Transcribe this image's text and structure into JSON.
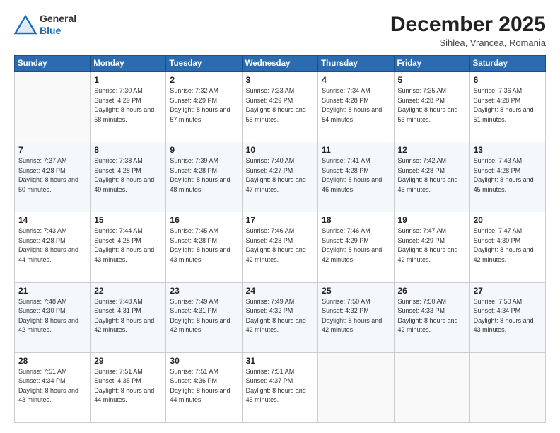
{
  "header": {
    "logo_general": "General",
    "logo_blue": "Blue",
    "month_title": "December 2025",
    "location": "Sihlea, Vrancea, Romania"
  },
  "weekdays": [
    "Sunday",
    "Monday",
    "Tuesday",
    "Wednesday",
    "Thursday",
    "Friday",
    "Saturday"
  ],
  "weeks": [
    [
      {
        "day": null,
        "sunrise": "",
        "sunset": "",
        "daylight": ""
      },
      {
        "day": "1",
        "sunrise": "7:30 AM",
        "sunset": "4:29 PM",
        "daylight": "8 hours and 58 minutes."
      },
      {
        "day": "2",
        "sunrise": "7:32 AM",
        "sunset": "4:29 PM",
        "daylight": "8 hours and 57 minutes."
      },
      {
        "day": "3",
        "sunrise": "7:33 AM",
        "sunset": "4:29 PM",
        "daylight": "8 hours and 55 minutes."
      },
      {
        "day": "4",
        "sunrise": "7:34 AM",
        "sunset": "4:28 PM",
        "daylight": "8 hours and 54 minutes."
      },
      {
        "day": "5",
        "sunrise": "7:35 AM",
        "sunset": "4:28 PM",
        "daylight": "8 hours and 53 minutes."
      },
      {
        "day": "6",
        "sunrise": "7:36 AM",
        "sunset": "4:28 PM",
        "daylight": "8 hours and 51 minutes."
      }
    ],
    [
      {
        "day": "7",
        "sunrise": "7:37 AM",
        "sunset": "4:28 PM",
        "daylight": "8 hours and 50 minutes."
      },
      {
        "day": "8",
        "sunrise": "7:38 AM",
        "sunset": "4:28 PM",
        "daylight": "8 hours and 49 minutes."
      },
      {
        "day": "9",
        "sunrise": "7:39 AM",
        "sunset": "4:28 PM",
        "daylight": "8 hours and 48 minutes."
      },
      {
        "day": "10",
        "sunrise": "7:40 AM",
        "sunset": "4:27 PM",
        "daylight": "8 hours and 47 minutes."
      },
      {
        "day": "11",
        "sunrise": "7:41 AM",
        "sunset": "4:28 PM",
        "daylight": "8 hours and 46 minutes."
      },
      {
        "day": "12",
        "sunrise": "7:42 AM",
        "sunset": "4:28 PM",
        "daylight": "8 hours and 45 minutes."
      },
      {
        "day": "13",
        "sunrise": "7:43 AM",
        "sunset": "4:28 PM",
        "daylight": "8 hours and 45 minutes."
      }
    ],
    [
      {
        "day": "14",
        "sunrise": "7:43 AM",
        "sunset": "4:28 PM",
        "daylight": "8 hours and 44 minutes."
      },
      {
        "day": "15",
        "sunrise": "7:44 AM",
        "sunset": "4:28 PM",
        "daylight": "8 hours and 43 minutes."
      },
      {
        "day": "16",
        "sunrise": "7:45 AM",
        "sunset": "4:28 PM",
        "daylight": "8 hours and 43 minutes."
      },
      {
        "day": "17",
        "sunrise": "7:46 AM",
        "sunset": "4:28 PM",
        "daylight": "8 hours and 42 minutes."
      },
      {
        "day": "18",
        "sunrise": "7:46 AM",
        "sunset": "4:29 PM",
        "daylight": "8 hours and 42 minutes."
      },
      {
        "day": "19",
        "sunrise": "7:47 AM",
        "sunset": "4:29 PM",
        "daylight": "8 hours and 42 minutes."
      },
      {
        "day": "20",
        "sunrise": "7:47 AM",
        "sunset": "4:30 PM",
        "daylight": "8 hours and 42 minutes."
      }
    ],
    [
      {
        "day": "21",
        "sunrise": "7:48 AM",
        "sunset": "4:30 PM",
        "daylight": "8 hours and 42 minutes."
      },
      {
        "day": "22",
        "sunrise": "7:48 AM",
        "sunset": "4:31 PM",
        "daylight": "8 hours and 42 minutes."
      },
      {
        "day": "23",
        "sunrise": "7:49 AM",
        "sunset": "4:31 PM",
        "daylight": "8 hours and 42 minutes."
      },
      {
        "day": "24",
        "sunrise": "7:49 AM",
        "sunset": "4:32 PM",
        "daylight": "8 hours and 42 minutes."
      },
      {
        "day": "25",
        "sunrise": "7:50 AM",
        "sunset": "4:32 PM",
        "daylight": "8 hours and 42 minutes."
      },
      {
        "day": "26",
        "sunrise": "7:50 AM",
        "sunset": "4:33 PM",
        "daylight": "8 hours and 42 minutes."
      },
      {
        "day": "27",
        "sunrise": "7:50 AM",
        "sunset": "4:34 PM",
        "daylight": "8 hours and 43 minutes."
      }
    ],
    [
      {
        "day": "28",
        "sunrise": "7:51 AM",
        "sunset": "4:34 PM",
        "daylight": "8 hours and 43 minutes."
      },
      {
        "day": "29",
        "sunrise": "7:51 AM",
        "sunset": "4:35 PM",
        "daylight": "8 hours and 44 minutes."
      },
      {
        "day": "30",
        "sunrise": "7:51 AM",
        "sunset": "4:36 PM",
        "daylight": "8 hours and 44 minutes."
      },
      {
        "day": "31",
        "sunrise": "7:51 AM",
        "sunset": "4:37 PM",
        "daylight": "8 hours and 45 minutes."
      },
      {
        "day": null,
        "sunrise": "",
        "sunset": "",
        "daylight": ""
      },
      {
        "day": null,
        "sunrise": "",
        "sunset": "",
        "daylight": ""
      },
      {
        "day": null,
        "sunrise": "",
        "sunset": "",
        "daylight": ""
      }
    ]
  ]
}
